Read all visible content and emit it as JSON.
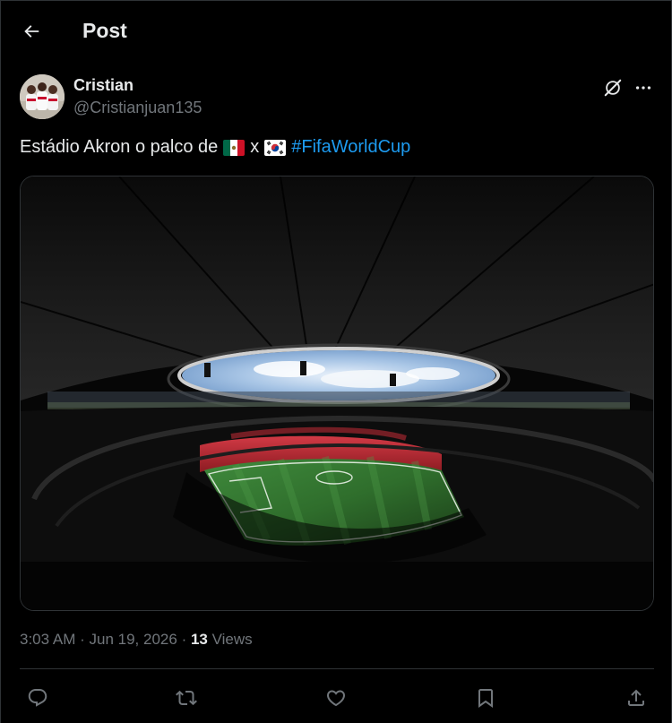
{
  "header": {
    "title": "Post"
  },
  "author": {
    "display_name": "Cristian",
    "handle": "@Cristianjuan135"
  },
  "tweet": {
    "text_before": "Estádio Akron o palco de",
    "text_middle": "x",
    "hashtag": "#FifaWorldCup",
    "flags": [
      "mexico-flag",
      "south-korea-flag"
    ]
  },
  "meta": {
    "time": "3:03 AM",
    "separator": "·",
    "date": "Jun 19, 2026",
    "separator2": "·",
    "views_count": "13",
    "views_label": "Views"
  },
  "icons": {
    "back": "arrow-left-icon",
    "grok": "grok-icon",
    "more": "more-icon",
    "reply": "reply-icon",
    "repost": "repost-icon",
    "like": "like-icon",
    "bookmark": "bookmark-icon",
    "share": "share-icon"
  },
  "colors": {
    "background": "#000000",
    "text": "#e7e9ea",
    "muted": "#71767b",
    "link": "#1d9bf0",
    "border": "#2f3336"
  }
}
